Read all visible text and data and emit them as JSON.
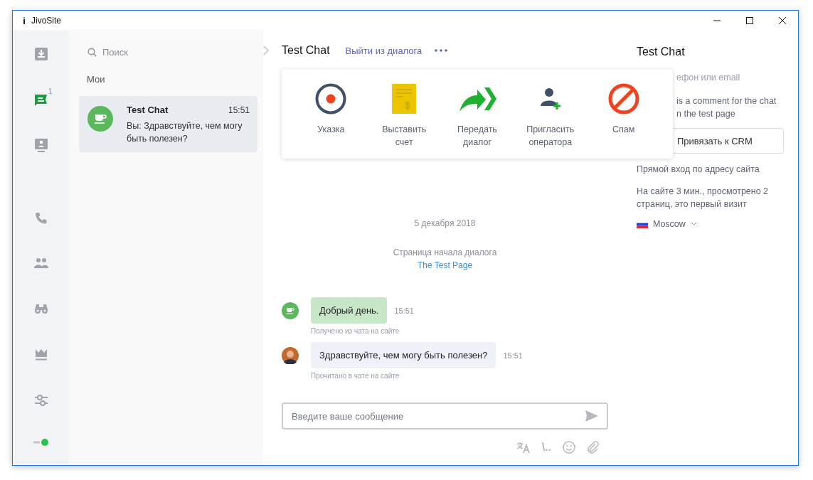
{
  "window": {
    "title": "JivoSite"
  },
  "rail": {
    "items": [
      {
        "selected": false
      },
      {
        "selected": true,
        "badge": "1"
      },
      {
        "selected": false
      },
      {
        "selected": false
      },
      {
        "selected": false
      },
      {
        "selected": false
      },
      {
        "selected": false
      },
      {
        "selected": false
      }
    ],
    "status_on": true
  },
  "chat_list": {
    "search": {
      "placeholder": "Поиск"
    },
    "section": "Мои",
    "items": [
      {
        "name": "Test Chat",
        "time": "15:51",
        "preview": "Вы: Здравствуйте, чем могу быть полезен?",
        "selected": true
      }
    ]
  },
  "chat": {
    "title": "Test Chat",
    "leave_link": "Выйти из диалога",
    "menu": {
      "actions": [
        {
          "label": "Указка"
        },
        {
          "label": "Выставить счет"
        },
        {
          "label": "Передать диалог"
        },
        {
          "label": "Пригласить оператора"
        },
        {
          "label": "Спам"
        }
      ]
    },
    "date": "5 декабря 2018",
    "start_page_label": "Страница начала диалога",
    "start_page_link": "The Test Page",
    "messages": [
      {
        "kind": "client",
        "text": "Добрый день.",
        "time": "15:51",
        "note": "Получено из чата на сайте"
      },
      {
        "kind": "agent",
        "text": "Здравствуйте, чем могу быть полезен?",
        "time": "15:51",
        "note": "Прочитано в чате на сайте"
      }
    ],
    "composer": {
      "placeholder": "Введите ваше сообщение",
      "shortcut_glyph": "\\.."
    }
  },
  "visitor": {
    "title": "Test Chat",
    "contact_placeholder": "ефон или email",
    "comment_lines": [
      "is a comment for the chat",
      "n the test page"
    ],
    "crm_button": "Привязать к CRM",
    "source": "Прямой вход по адресу сайта",
    "visit_info": "На сайте 3 мин., просмотрено 2 страниц, это первый визит",
    "location": "Moscow"
  }
}
